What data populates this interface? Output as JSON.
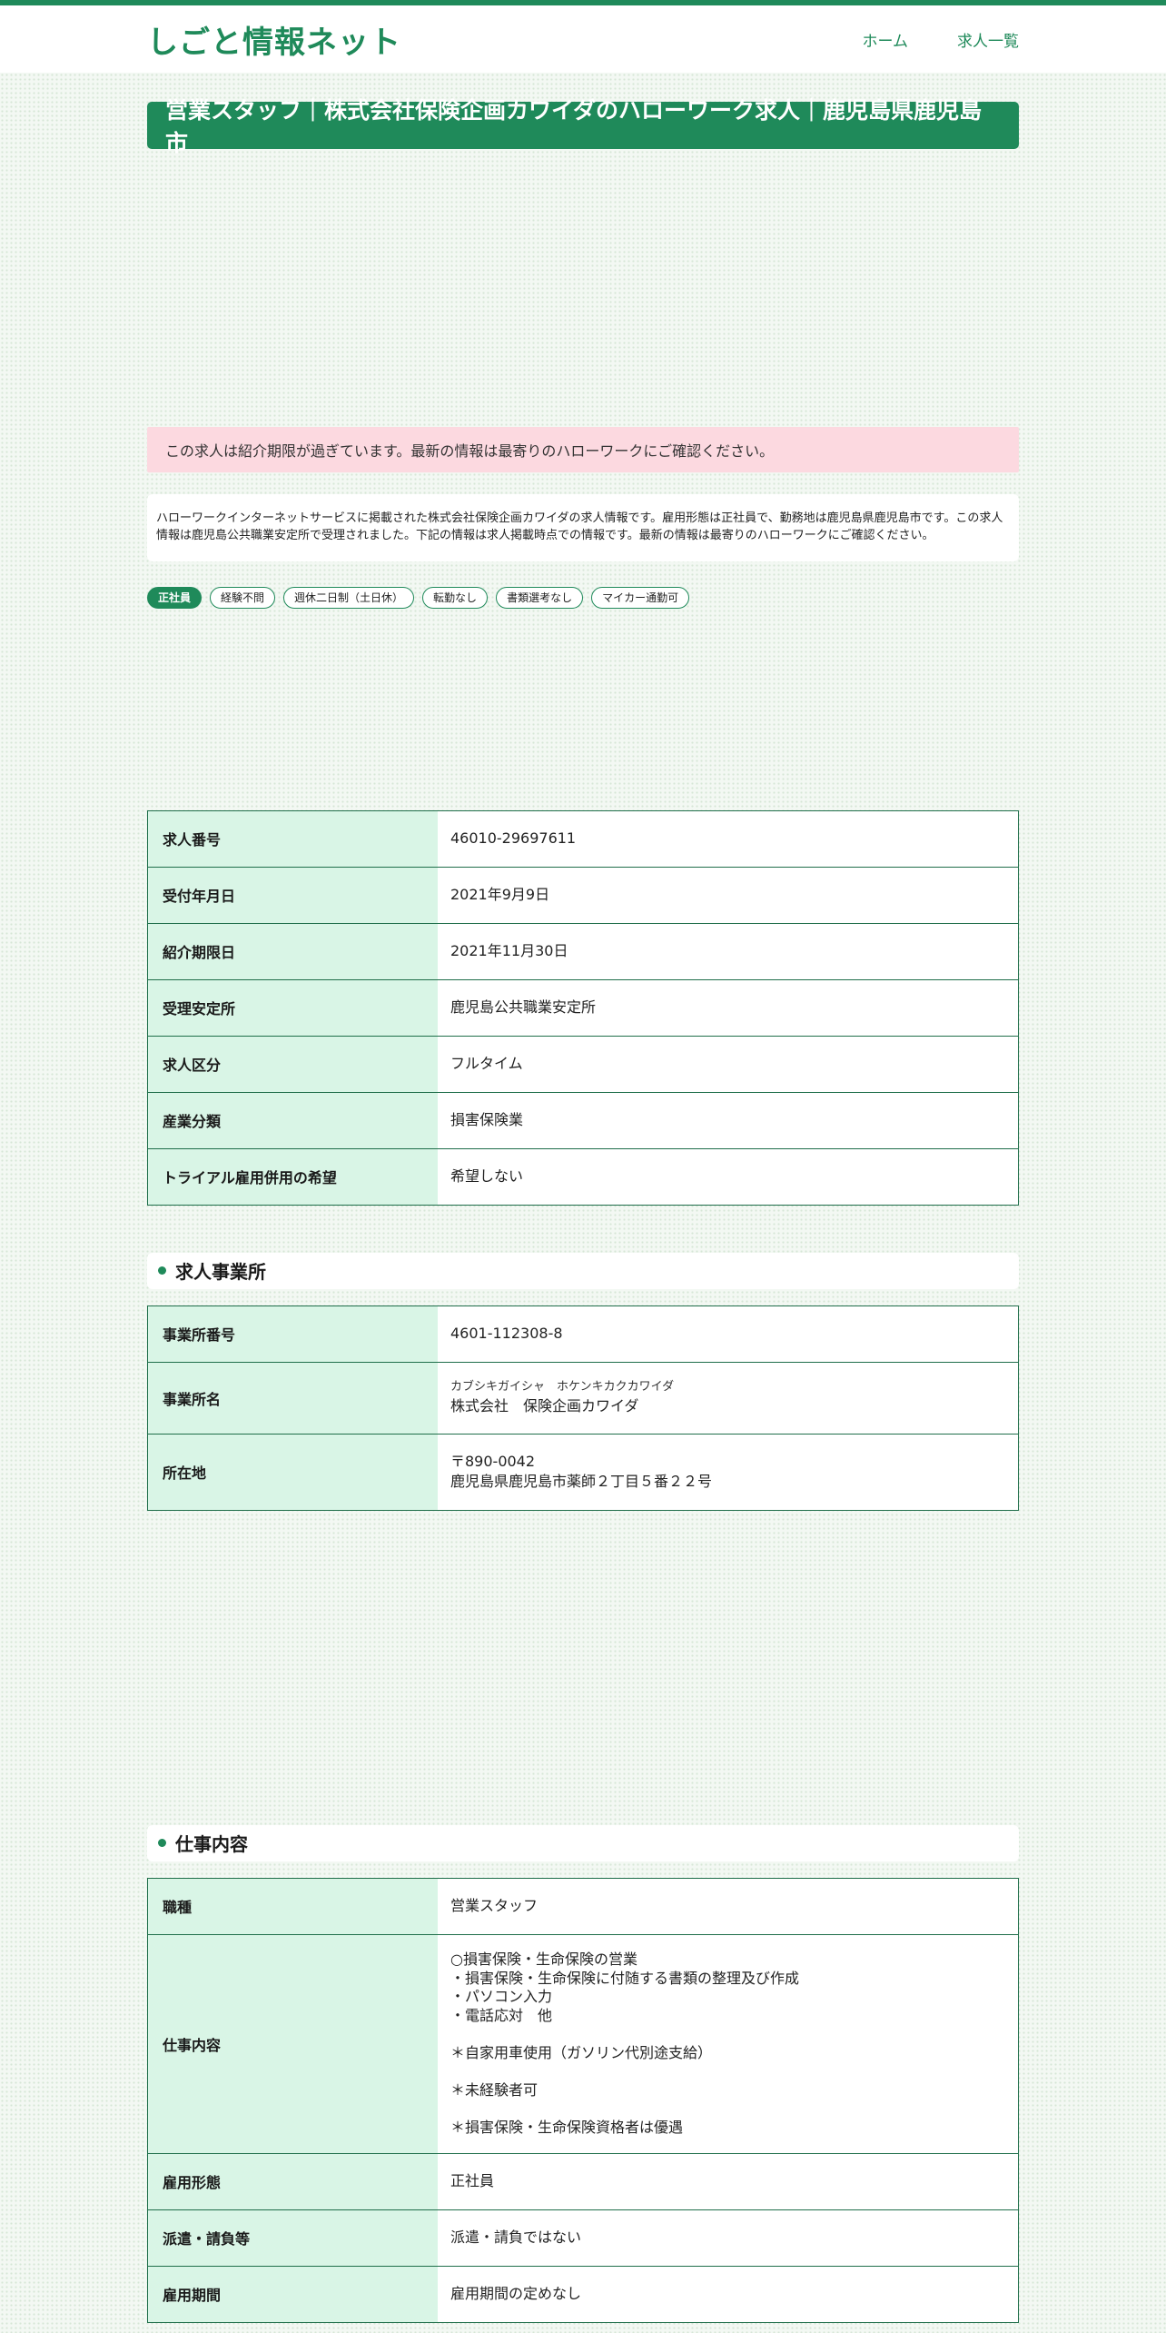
{
  "site": {
    "logo": "しごと情報ネット",
    "nav": [
      "ホーム",
      "求人一覧"
    ]
  },
  "page_title": "営業スタッフ｜株式会社保険企画カワイダのハローワーク求人｜鹿児島県鹿児島市",
  "notice": "この求人は紹介期限が過ぎています。最新の情報は最寄りのハローワークにご確認ください。",
  "intro": "ハローワークインターネットサービスに掲載された株式会社保険企画カワイダの求人情報です。雇用形態は正社員で、勤務地は鹿児島県鹿児島市です。この求人情報は鹿児島公共職業安定所で受理されました。下記の情報は求人掲載時点での情報です。最新の情報は最寄りのハローワークにご確認ください。",
  "tags": [
    "正社員",
    "経験不問",
    "週休二日制（土日休）",
    "転勤なし",
    "書類選考なし",
    "マイカー通勤可"
  ],
  "summary": [
    {
      "label": "求人番号",
      "value": "46010-29697611"
    },
    {
      "label": "受付年月日",
      "value": "2021年9月9日"
    },
    {
      "label": "紹介期限日",
      "value": "2021年11月30日"
    },
    {
      "label": "受理安定所",
      "value": "鹿児島公共職業安定所"
    },
    {
      "label": "求人区分",
      "value": "フルタイム"
    },
    {
      "label": "産業分類",
      "value": "損害保険業"
    },
    {
      "label": "トライアル雇用併用の希望",
      "value": "希望しない"
    }
  ],
  "employer": {
    "heading": "求人事業所",
    "office_no_label": "事業所番号",
    "office_no": "4601-112308-8",
    "name_label": "事業所名",
    "name_kana": "カブシキガイシャ　ホケンキカクカワイダ",
    "name": "株式会社　保険企画カワイダ",
    "address_label": "所在地",
    "postal": "〒890-0042",
    "address": "鹿児島県鹿児島市薬師２丁目５番２２号"
  },
  "job": {
    "heading": "仕事内容",
    "type_label": "職種",
    "type": "営業スタッフ",
    "content_label": "仕事内容",
    "content": "○損害保険・生命保険の営業\n・損害保険・生命保険に付随する書類の整理及び作成\n・パソコン入力\n・電話応対　他\n\n＊自家用車使用（ガソリン代別途支給）\n\n＊未経験者可\n\n＊損害保険・生命保険資格者は優遇",
    "employment_label": "雇用形態",
    "employment": "正社員",
    "dispatch_label": "派遣・請負等",
    "dispatch": "派遣・請負ではない",
    "period_label": "雇用期間",
    "period": "雇用期間の定めなし"
  },
  "colors": {
    "accent": "#1f8a5a",
    "notice_bg": "#fcd9e0",
    "label_bg": "#d9f5e6"
  }
}
